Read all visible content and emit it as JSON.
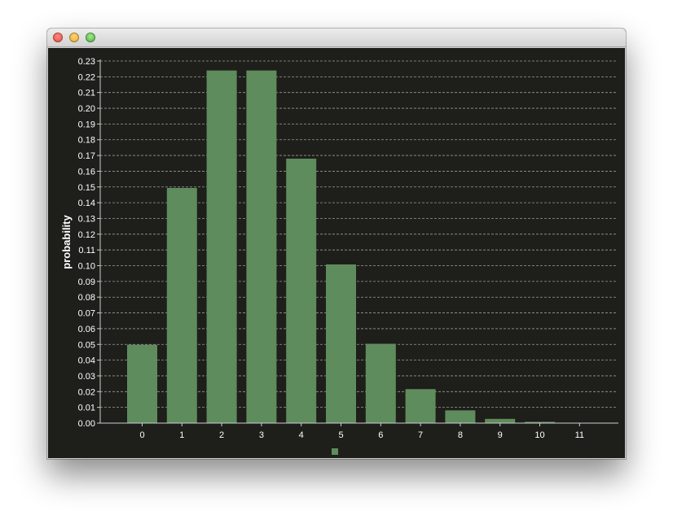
{
  "chart_data": {
    "type": "bar",
    "title": "",
    "xlabel": "",
    "ylabel": "probability",
    "categories": [
      "0",
      "1",
      "2",
      "3",
      "4",
      "5",
      "6",
      "7",
      "8",
      "9",
      "10",
      "11"
    ],
    "values": [
      0.0498,
      0.1494,
      0.224,
      0.224,
      0.168,
      0.1008,
      0.0504,
      0.0216,
      0.0081,
      0.0027,
      0.0008,
      0.0002
    ],
    "ylim": [
      0,
      0.23
    ],
    "yticks": [
      "0.00",
      "0.01",
      "0.02",
      "0.03",
      "0.04",
      "0.05",
      "0.06",
      "0.07",
      "0.08",
      "0.09",
      "0.10",
      "0.11",
      "0.12",
      "0.13",
      "0.14",
      "0.15",
      "0.16",
      "0.17",
      "0.18",
      "0.19",
      "0.20",
      "0.21",
      "0.22",
      "0.23"
    ],
    "grid": true,
    "legend": "bottom-center",
    "colors": {
      "bar": "#5e8c5c",
      "background": "#1e1e1b",
      "grid": "#9a9a96",
      "text": "#ffffff"
    }
  }
}
